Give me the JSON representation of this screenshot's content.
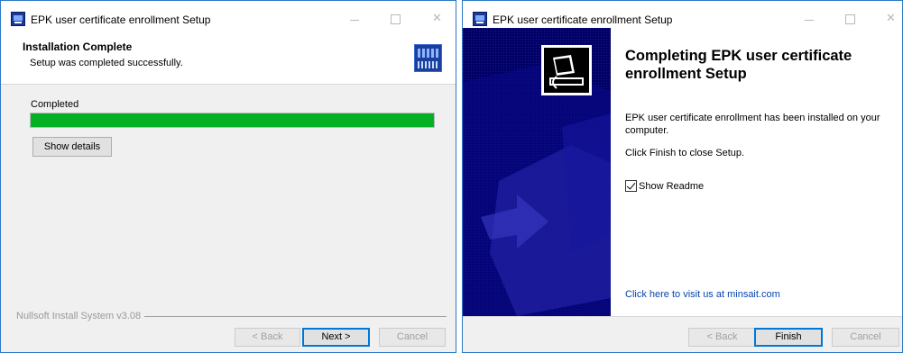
{
  "colors": {
    "progress": "#06b025",
    "side_panel": "#000066",
    "accent": "#0078d7"
  },
  "window1": {
    "title": "EPK user certificate enrollment Setup",
    "icons": [
      "installer-app-icon",
      "minimize-icon",
      "maximize-icon",
      "close-icon",
      "header-logo-icon"
    ],
    "header": {
      "title": "Installation Complete",
      "subtitle": "Setup was completed successfully."
    },
    "status_label": "Completed",
    "progress": 1.0,
    "show_details_label": "Show details",
    "branding": "Nullsoft Install System v3.08",
    "buttons": {
      "back": "< Back",
      "next": "Next >",
      "cancel": "Cancel"
    }
  },
  "window2": {
    "title": "EPK user certificate enrollment Setup",
    "icons": [
      "installer-app-icon",
      "minimize-icon",
      "maximize-icon",
      "close-icon",
      "installer-computer-icon"
    ],
    "heading": "Completing EPK user certificate enrollment Setup",
    "installed_message": "EPK user certificate enrollment has been installed on your computer.",
    "finish_hint": "Click Finish to close Setup.",
    "readme_label": "Show Readme",
    "readme_checked": true,
    "link_text": "Click here to visit us at minsait.com",
    "buttons": {
      "back": "< Back",
      "finish": "Finish",
      "cancel": "Cancel"
    }
  }
}
